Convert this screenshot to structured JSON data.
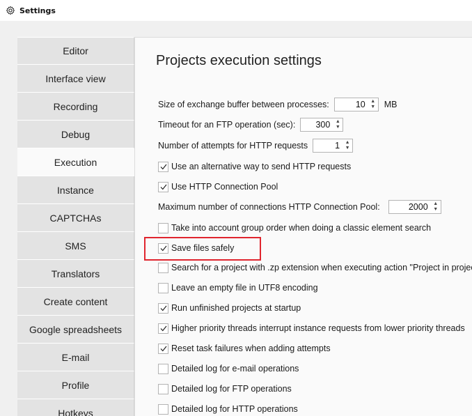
{
  "window": {
    "title": "Settings",
    "icon": "gear-icon"
  },
  "sidebar": {
    "items": [
      {
        "label": "Editor",
        "active": false
      },
      {
        "label": "Interface view",
        "active": false
      },
      {
        "label": "Recording",
        "active": false
      },
      {
        "label": "Debug",
        "active": false
      },
      {
        "label": "Execution",
        "active": true
      },
      {
        "label": "Instance",
        "active": false
      },
      {
        "label": "CAPTCHAs",
        "active": false
      },
      {
        "label": "SMS",
        "active": false
      },
      {
        "label": "Translators",
        "active": false
      },
      {
        "label": "Create content",
        "active": false
      },
      {
        "label": "Google spreadsheets",
        "active": false
      },
      {
        "label": "E-mail",
        "active": false
      },
      {
        "label": "Profile",
        "active": false
      },
      {
        "label": "Hotkeys",
        "active": false
      }
    ]
  },
  "panel": {
    "title": "Projects execution settings",
    "buffer": {
      "label": "Size of exchange buffer between processes:",
      "value": "10",
      "unit": "MB"
    },
    "ftp_timeout": {
      "label": "Timeout for an FTP operation (sec):",
      "value": "300"
    },
    "http_attempts": {
      "label": "Number of attempts for HTTP requests",
      "value": "1"
    },
    "alt_http": {
      "label": "Use an alternative way to send HTTP requests",
      "checked": true
    },
    "conn_pool": {
      "label": "Use HTTP Connection Pool",
      "checked": true
    },
    "max_conn": {
      "label": "Maximum number of connections HTTP Connection Pool:",
      "value": "2000"
    },
    "group_order": {
      "label": "Take into account group order when doing a classic element search",
      "checked": false
    },
    "save_safely": {
      "label": "Save files safely",
      "checked": true
    },
    "zp_search": {
      "label": "Search for a project with .zp extension when executing action \"Project in project\"",
      "checked": false
    },
    "utf8_empty": {
      "label": "Leave an empty file in UTF8 encoding",
      "checked": false
    },
    "run_unfinished": {
      "label": "Run unfinished projects at startup",
      "checked": true
    },
    "priority_threads": {
      "label": "Higher priority threads interrupt instance requests from lower priority threads",
      "checked": true
    },
    "reset_failures": {
      "label": "Reset task failures when adding attempts",
      "checked": true
    },
    "log_email": {
      "label": "Detailed log for e-mail operations",
      "checked": false
    },
    "log_ftp": {
      "label": "Detailed log for FTP operations",
      "checked": false
    },
    "log_http": {
      "label": "Detailed log for HTTP operations",
      "checked": false
    }
  },
  "colors": {
    "highlight": "#e0252e",
    "background": "#f0f0f0",
    "panel": "#fafafa",
    "nav": "#e3e3e3"
  }
}
